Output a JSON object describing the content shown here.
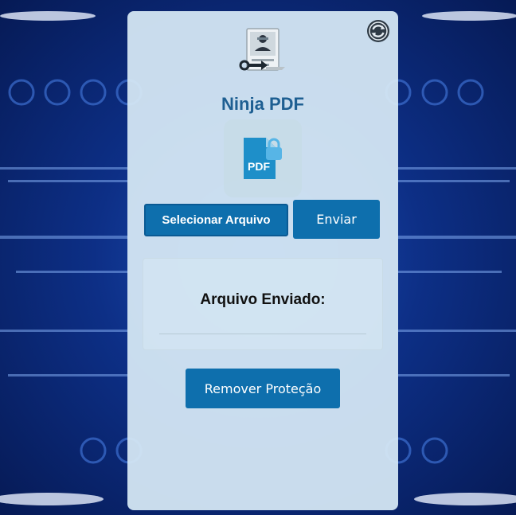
{
  "app": {
    "title": "Ninja PDF"
  },
  "icons": {
    "refresh": "refresh-icon",
    "logo": "ninja-document-key-icon",
    "pdf": "pdf-file-lock-icon"
  },
  "actions": {
    "select_label": "Selecionar Arquivo",
    "send_label": "Enviar",
    "remove_label": "Remover Proteção"
  },
  "upload_panel": {
    "title": "Arquivo Enviado:"
  },
  "colors": {
    "accent": "#0e6fad",
    "title": "#1e5f92",
    "card": "#d6e8f4"
  }
}
